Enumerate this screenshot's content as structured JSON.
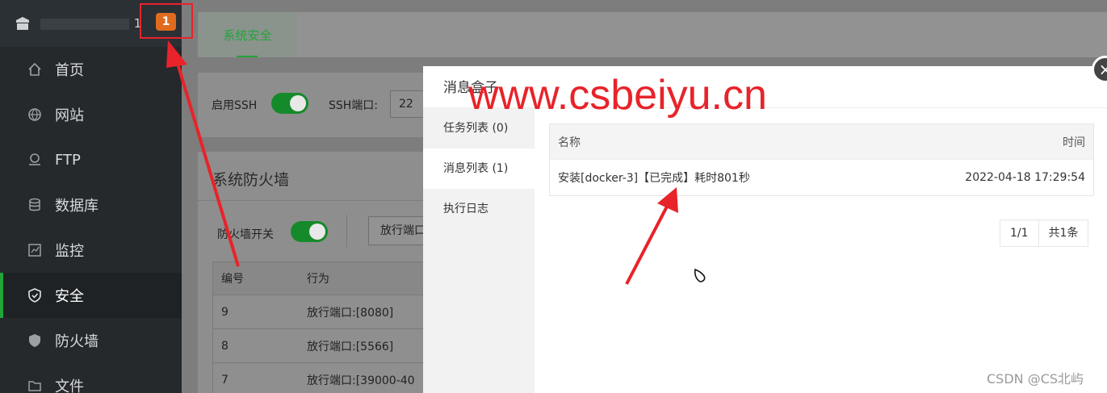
{
  "header": {
    "badge_count": "1",
    "site_label": "1"
  },
  "sidebar": {
    "items": [
      {
        "label": "首页",
        "icon": "home-icon"
      },
      {
        "label": "网站",
        "icon": "globe-icon"
      },
      {
        "label": "FTP",
        "icon": "ftp-icon"
      },
      {
        "label": "数据库",
        "icon": "database-icon"
      },
      {
        "label": "监控",
        "icon": "monitor-icon"
      },
      {
        "label": "安全",
        "icon": "shield-icon",
        "active": true
      },
      {
        "label": "防火墙",
        "icon": "firewall-shield-icon"
      },
      {
        "label": "文件",
        "icon": "folder-icon"
      }
    ]
  },
  "main": {
    "tab_label": "系统安全",
    "ssh_enable_label": "启用SSH",
    "ssh_port_label": "SSH端口:",
    "ssh_port_value": "22",
    "firewall_title": "系统防火墙",
    "firewall_switch_label": "防火墙开关",
    "open_port_button": "放行端口",
    "table": {
      "headers": [
        "编号",
        "行为"
      ],
      "rows": [
        [
          "9",
          "放行端口:[8080]"
        ],
        [
          "8",
          "放行端口:[5566]"
        ],
        [
          "7",
          "放行端口:[39000-40"
        ]
      ]
    }
  },
  "modal": {
    "title": "消息盒子",
    "close_symbol": "×",
    "side_items": [
      "任务列表 (0)",
      "消息列表 (1)",
      "执行日志"
    ],
    "table_headers": {
      "name": "名称",
      "time": "时间"
    },
    "message": {
      "name": "安装[docker-3]【已完成】耗时801秒",
      "time": "2022-04-18 17:29:54"
    },
    "pager": {
      "current": "1/1",
      "total": "共1条"
    }
  },
  "watermark": "www.csbeiyu.cn",
  "csdn_credit": "CSDN @CS北屿",
  "colors": {
    "accent": "#20a53a",
    "annotation_red": "#e8232a",
    "badge": "#e06b1f"
  }
}
